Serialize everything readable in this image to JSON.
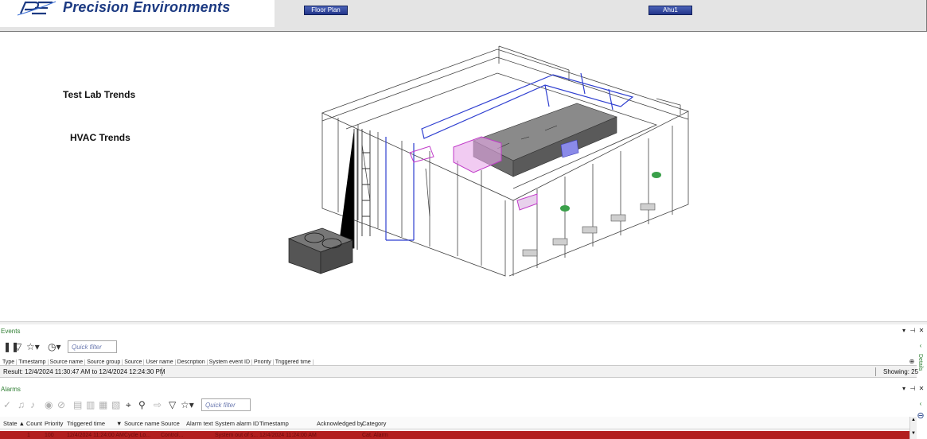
{
  "header": {
    "logo_text": "Precision Environments",
    "buttons": {
      "floor_plan": "Floor Plan",
      "ahu1": "Ahu1"
    }
  },
  "links": {
    "test_lab_trends": "Test Lab Trends",
    "hvac_trends": "HVAC Trends"
  },
  "events": {
    "title": "Events",
    "quick_filter_placeholder": "Quick filter",
    "columns": [
      "Type",
      "Timestamp",
      "Source name",
      "Source group",
      "Source",
      "User name",
      "Description",
      "System event ID",
      "Priority",
      "Triggered time"
    ],
    "result_text": "Result:  12/4/2024 11:30:47 AM  to  12/4/2024 12:24:30 PM",
    "showing_text": "Showing: 25",
    "details_label": "Details"
  },
  "alarms": {
    "title": "Alarms",
    "quick_filter_placeholder": "Quick filter",
    "columns": [
      "State",
      "Count",
      "Priority",
      "Triggered time",
      "Source name",
      "Source",
      "Alarm text",
      "System alarm ID",
      "Timestamp",
      "Acknowledged by",
      "Category"
    ],
    "row": [
      "1",
      "100",
      "12/4/2024 11:24:00 AM",
      "Cycle Lo...",
      "Control...",
      "System out of s...",
      "12/4/2024 11:24:00 AM",
      "Cat. Alarm"
    ]
  },
  "colors": {
    "brand": "#1c3a82",
    "status_green": "#2e7d32",
    "alarm_red": "#b21f1f"
  },
  "icons": {
    "events_toolbar": [
      "pause-icon",
      "filter-icon",
      "star-dropdown-icon",
      "clock-dropdown-icon"
    ],
    "alarms_toolbar": [
      "acknowledge-icon",
      "bell-icon",
      "bell-muted-icon",
      "eye-icon",
      "eye-off-icon",
      "note-icon",
      "export-icon",
      "copy-icon",
      "grid-icon",
      "location-icon",
      "tag-icon",
      "arrow-icon",
      "filter-icon",
      "star-dropdown-icon"
    ]
  }
}
